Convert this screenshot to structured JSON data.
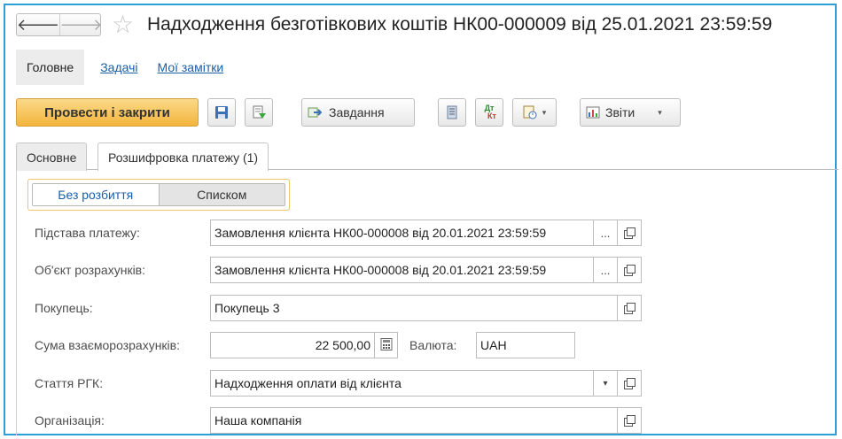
{
  "window": {
    "title": "Надходження безготівкових коштів НК00-000009 від 25.01.2021 23:59:59",
    "back_glyph": "🡐",
    "forward_glyph": "🡒",
    "star_glyph": "☆"
  },
  "sections": {
    "main": "Головне",
    "tasks": "Задачі",
    "notes": "Мої замітки"
  },
  "toolbar": {
    "post_close": "Провести і закрити",
    "tasks": "Завдання",
    "reports": "Звіти",
    "dtkt_top": "Дт",
    "dtkt_bottom": "Кт"
  },
  "tabs": [
    {
      "label": "Основне",
      "active": false
    },
    {
      "label": "Розшифровка платежу (1)",
      "active": true
    }
  ],
  "mode": {
    "options": [
      "Без розбиття",
      "Списком"
    ],
    "selected": "Без розбиття"
  },
  "form": {
    "basis_label": "Підстава платежу:",
    "basis_value": "Замовлення клієнта НК00-000008 від 20.01.2021 23:59:59",
    "object_label": "Об'єкт розрахунків:",
    "object_value": "Замовлення клієнта НК00-000008 від 20.01.2021 23:59:59",
    "buyer_label": "Покупець:",
    "buyer_value": "Покупець 3",
    "amount_label": "Сума взаєморозрахунків:",
    "amount_value": "22 500,00",
    "currency_label": "Валюта:",
    "currency_value": "UAH",
    "article_label": "Стаття РГК:",
    "article_value": "Надходження оплати від клієнта",
    "org_label": "Організація:",
    "org_value": "Наша компанія",
    "select_glyph": "...",
    "dropdown_glyph": "▾"
  },
  "colors": {
    "frame": "#2a9fd8",
    "primary_button": "#f3b53c",
    "link": "#1b5fa7"
  }
}
